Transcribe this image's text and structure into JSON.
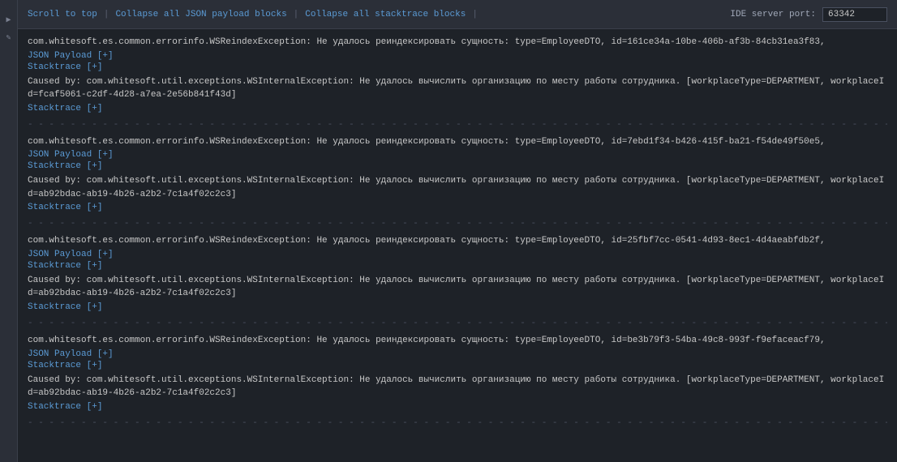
{
  "toolbar": {
    "scroll_to_top": "Scroll to top",
    "collapse_json": "Collapse all JSON payload blocks",
    "collapse_stack": "Collapse all stacktrace blocks",
    "ide_port_label": "IDE server port:",
    "ide_port_value": "63342"
  },
  "separator": "- - - - - - - - - - - - - - - - - - - - - - - - - - - - - - - - - - - - - - - - - - - - - - - - - - - - - - - - - - - - - - - - - - - - - - - - - - - - - - - - - - - - - - - - - - - - - - - - - - - - - - - - - - - - - - - - - - - - - - - - - - - - - - - - - - - - - - - - - - - - - - - - - - - - - - - - - - - - - - - - - - - - - - - - - - - - - - - - - - - - - - - - - - - - - - - - - - - - - - - - - - - - - - - - - - - - - - - - - - - - - - - - - - - - - - - - - - - - - - - - - - - - - - - - - - - - - - - - - - - - - - - - - - - - - - - - - - - - - - - - - - - - - - - - -",
  "errors": [
    {
      "id": 1,
      "main": "com.whitesoft.es.common.errorinfo.WSReindexException: Не удалось реиндексировать сущность: type=EmployeeDTO, id=161ce34a-10be-406b-af3b-84cb31ea3f83,",
      "json_payload": "JSON Payload [+]",
      "stacktrace": "Stacktrace [+]",
      "caused_by": "Caused by: com.whitesoft.util.exceptions.WSInternalException: Не удалось вычислить организацию по месту работы сотрудника. [workplaceType=DEPARTMENT, workplaceId=fcaf5061-c2df-4d28-a7ea-2e56b841f43d]",
      "caused_stacktrace": "Stacktrace [+]"
    },
    {
      "id": 2,
      "main": "com.whitesoft.es.common.errorinfo.WSReindexException: Не удалось реиндексировать сущность: type=EmployeeDTO, id=7ebd1f34-b426-415f-ba21-f54de49f50e5,",
      "json_payload": "JSON Payload [+]",
      "stacktrace": "Stacktrace [+]",
      "caused_by": "Caused by: com.whitesoft.util.exceptions.WSInternalException: Не удалось вычислить организацию по месту работы сотрудника. [workplaceType=DEPARTMENT, workplaceId=ab92bdac-ab19-4b26-a2b2-7c1a4f02c2c3]",
      "caused_stacktrace": "Stacktrace [+]"
    },
    {
      "id": 3,
      "main": "com.whitesoft.es.common.errorinfo.WSReindexException: Не удалось реиндексировать сущность: type=EmployeeDTO, id=25fbf7cc-0541-4d93-8ec1-4d4aeabfdb2f,",
      "json_payload": "JSON Payload [+]",
      "stacktrace": "Stacktrace [+]",
      "caused_by": "Caused by: com.whitesoft.util.exceptions.WSInternalException: Не удалось вычислить организацию по месту работы сотрудника. [workplaceType=DEPARTMENT, workplaceId=ab92bdac-ab19-4b26-a2b2-7c1a4f02c2c3]",
      "caused_stacktrace": "Stacktrace [+]"
    },
    {
      "id": 4,
      "main": "com.whitesoft.es.common.errorinfo.WSReindexException: Не удалось реиндексировать сущность: type=EmployeeDTO, id=be3b79f3-54ba-49c8-993f-f9efaceacf79,",
      "json_payload": "JSON Payload [+]",
      "stacktrace": "Stacktrace [+]",
      "caused_by": "Caused by: com.whitesoft.util.exceptions.WSInternalException: Не удалось вычислить организацию по месту работы сотрудника. [workplaceType=DEPARTMENT, workplaceId=ab92bdac-ab19-4b26-a2b2-7c1a4f02c2c3]",
      "caused_stacktrace": "Stacktrace [+]"
    }
  ]
}
